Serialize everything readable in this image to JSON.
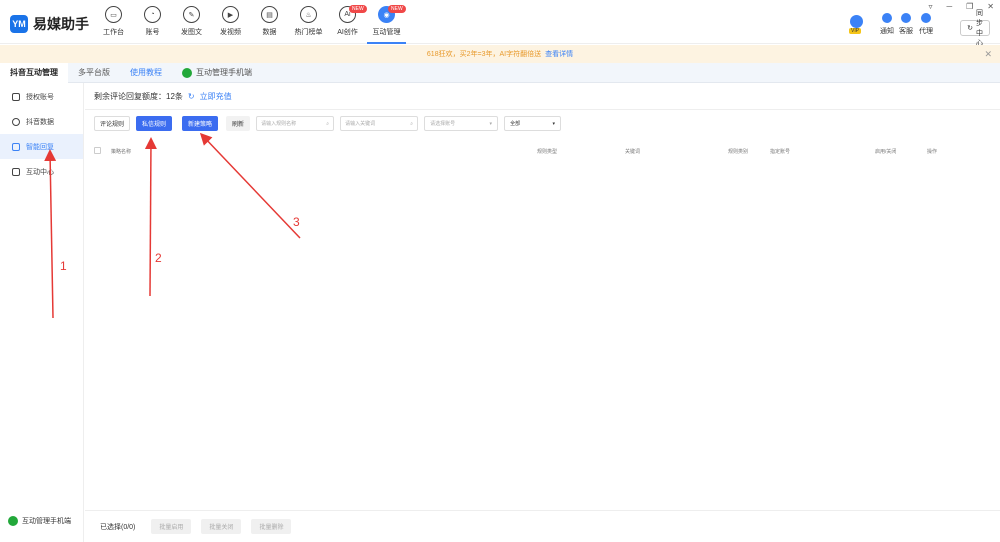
{
  "app": {
    "logo_mark": "YM",
    "title": "易媒助手"
  },
  "nav": [
    {
      "label": "工作台",
      "icon": "monitor-icon",
      "glyph": "▭"
    },
    {
      "label": "账号",
      "icon": "user-icon",
      "glyph": "◔"
    },
    {
      "label": "发图文",
      "icon": "pen-icon",
      "glyph": "✎"
    },
    {
      "label": "发视频",
      "icon": "play-icon",
      "glyph": "▶"
    },
    {
      "label": "数据",
      "icon": "data-icon",
      "glyph": "▤"
    },
    {
      "label": "热门榜单",
      "icon": "flame-icon",
      "glyph": "♨"
    },
    {
      "label": "AI创作",
      "icon": "ai-icon",
      "glyph": "Ai",
      "badge": "NEW"
    },
    {
      "label": "互动管理",
      "icon": "chat-icon",
      "glyph": "◉",
      "badge": "NEW",
      "active": true
    }
  ],
  "header_right": {
    "vip": "VIP",
    "notify": "通知",
    "service": "客服",
    "agent": "代理",
    "sync": "同步中心"
  },
  "window_controls": [
    "▿",
    "─",
    "❐",
    "✕"
  ],
  "banner": {
    "text": "618狂欢，买2年=3年，AI字符翻倍送",
    "link": "查看详情",
    "close": "✕"
  },
  "tabs": {
    "active": "抖音互动管理",
    "multi": "多平台版",
    "tutorial": "使用教程",
    "mobile": "互动管理手机端"
  },
  "sidebar": {
    "items": [
      {
        "label": "授权账号",
        "icon": "shield-icon"
      },
      {
        "label": "抖音数据",
        "icon": "check-circle-icon"
      },
      {
        "label": "智能回复",
        "icon": "reply-icon",
        "active": true
      },
      {
        "label": "互动中心",
        "icon": "message-icon"
      }
    ],
    "bottom": "互动管理手机端"
  },
  "main": {
    "quota_label": "剩余评论回复额度：12条",
    "refresh_glyph": "↻",
    "recharge": "立即充值",
    "toolbar": {
      "comment_rule": "评论规则",
      "dm_rule": "私信规则",
      "new_strategy": "新建策略",
      "refresh": "刷新",
      "rule_name_placeholder": "请输入规则名称",
      "keyword_placeholder": "请输入关键词",
      "account_placeholder": "请选择账号",
      "status_select": "全部"
    },
    "columns": [
      "策略名称",
      "规则类型",
      "关键词",
      "规则类别",
      "指定账号",
      "启用/关闭",
      "操作"
    ],
    "footer": {
      "selected": "已选择(0/0)",
      "batch_enable": "批量启用",
      "batch_disable": "批量关闭",
      "batch_delete": "批量删除"
    }
  },
  "annotations": [
    {
      "label": "1"
    },
    {
      "label": "2"
    },
    {
      "label": "3"
    }
  ],
  "colors": {
    "accent": "#3b82f6",
    "primary_button": "#3b6cf0",
    "annotation": "#e53935",
    "banner_bg": "#fdf3e1"
  }
}
